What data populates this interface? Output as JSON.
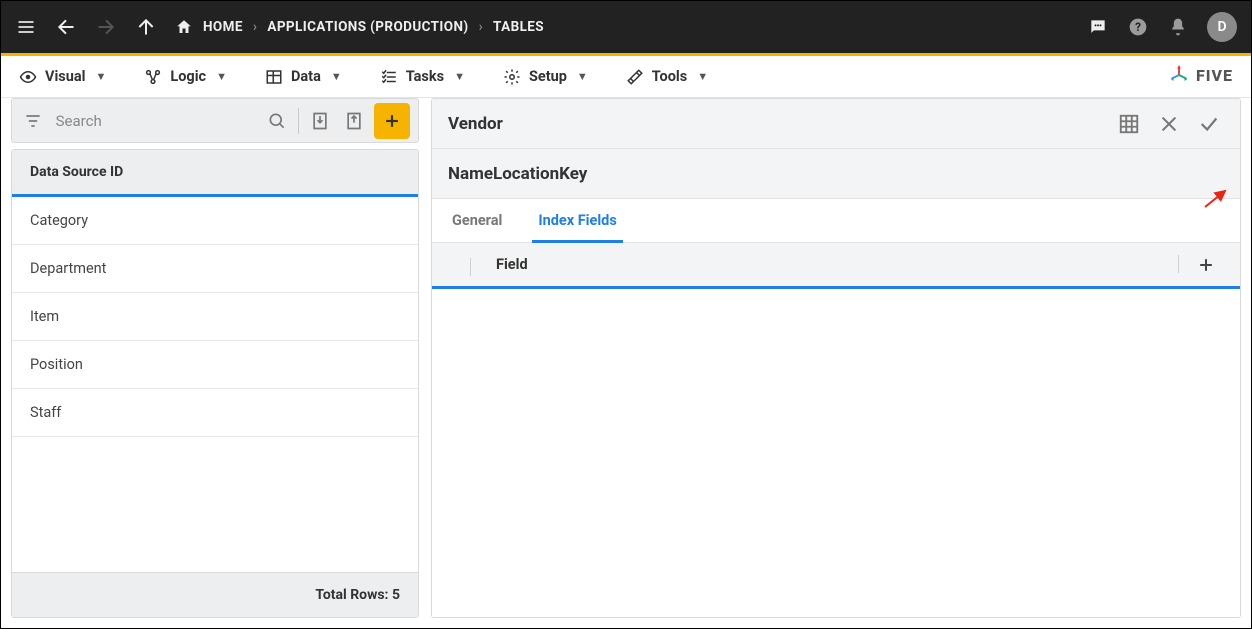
{
  "topbar": {
    "breadcrumbs": [
      "HOME",
      "APPLICATIONS (PRODUCTION)",
      "TABLES"
    ],
    "avatar_initial": "D"
  },
  "menubar": {
    "items": [
      {
        "label": "Visual"
      },
      {
        "label": "Logic"
      },
      {
        "label": "Data"
      },
      {
        "label": "Tasks"
      },
      {
        "label": "Setup"
      },
      {
        "label": "Tools"
      }
    ],
    "brand": "FIVE"
  },
  "left_panel": {
    "search_placeholder": "Search",
    "list_header": "Data Source ID",
    "rows": [
      "Category",
      "Department",
      "Item",
      "Position",
      "Staff"
    ],
    "footer_label": "Total Rows: 5"
  },
  "right_panel": {
    "header1_title": "Vendor",
    "header2_title": "NameLocationKey",
    "tabs": [
      {
        "label": "General",
        "active": false
      },
      {
        "label": "Index Fields",
        "active": true
      }
    ],
    "field_column_label": "Field"
  }
}
